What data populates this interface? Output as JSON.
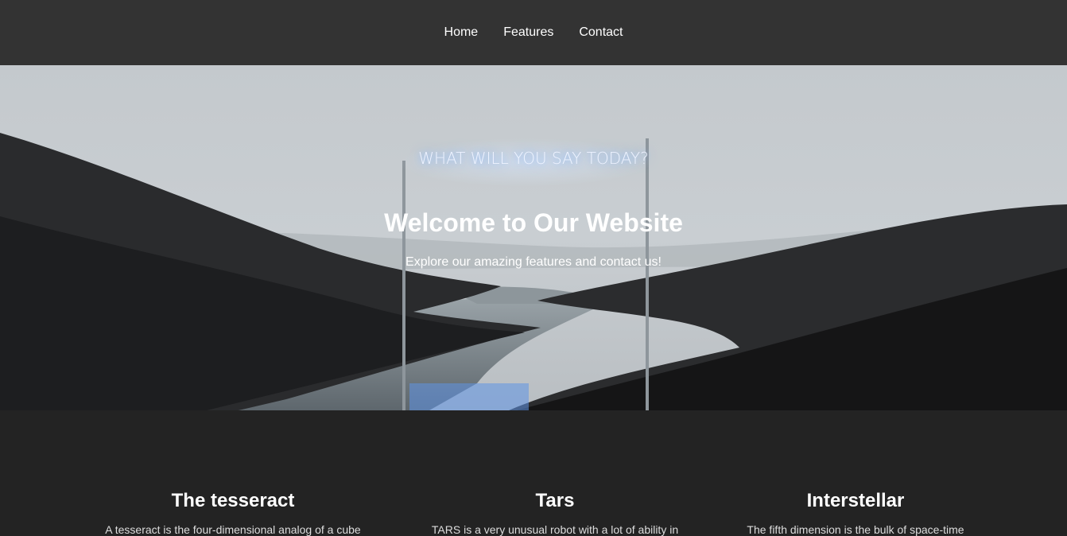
{
  "nav": {
    "items": [
      {
        "label": "Home"
      },
      {
        "label": "Features"
      },
      {
        "label": "Contact"
      }
    ]
  },
  "hero": {
    "sign_text": "WHAT WILL YOU SAY TODAY?",
    "title": "Welcome to Our Website",
    "subtitle": "Explore our amazing features and contact us!"
  },
  "features": [
    {
      "title": "The tesseract",
      "text": "A tesseract is the four-dimensional analog of a cube"
    },
    {
      "title": "Tars",
      "text": "TARS is a very unusual robot with a lot of ability in"
    },
    {
      "title": "Interstellar",
      "text": "The fifth dimension is the bulk of space-time"
    }
  ],
  "colors": {
    "nav_bg": "#333333",
    "page_bg": "#232323",
    "neon": "#9ec7ff"
  }
}
